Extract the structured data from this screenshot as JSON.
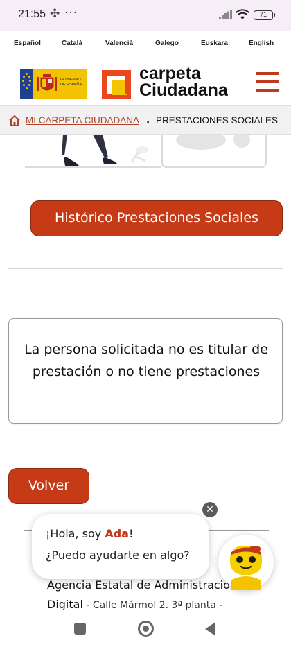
{
  "status_bar": {
    "time": "21:55",
    "dots": "···",
    "battery": "71"
  },
  "languages": [
    "Español",
    "Català",
    "Valencià",
    "Galego",
    "Euskara",
    "English"
  ],
  "header": {
    "gov_logo_text": "GOBIERNO DE ESPAÑA",
    "brand_line1": "carpeta",
    "brand_line2": "Ciudadana"
  },
  "breadcrumb": {
    "home_link": "MI CARPETA CIUDADANA",
    "separator": ".",
    "current": "PRESTACIONES SOCIALES"
  },
  "main": {
    "historic_button": "Histórico Prestaciones Sociales",
    "message": "La persona solicitada no es titular de prestación o no tiene prestaciones",
    "back_button": "Volver"
  },
  "chat": {
    "greeting_prefix": "¡Hola, soy ",
    "assistant_name": "Ada",
    "greeting_suffix": "!",
    "question": "¿Puedo ayudarte en algo?",
    "close_symbol": "✕"
  },
  "footer": {
    "agency": "Agencia Estatal de Administración",
    "line2_word": "Digital",
    "address": " - Calle Mármol 2. 3ª planta -"
  },
  "colors": {
    "accent": "#c63b16",
    "brand_orange": "#e8481c",
    "ada_red": "#c0391b"
  }
}
